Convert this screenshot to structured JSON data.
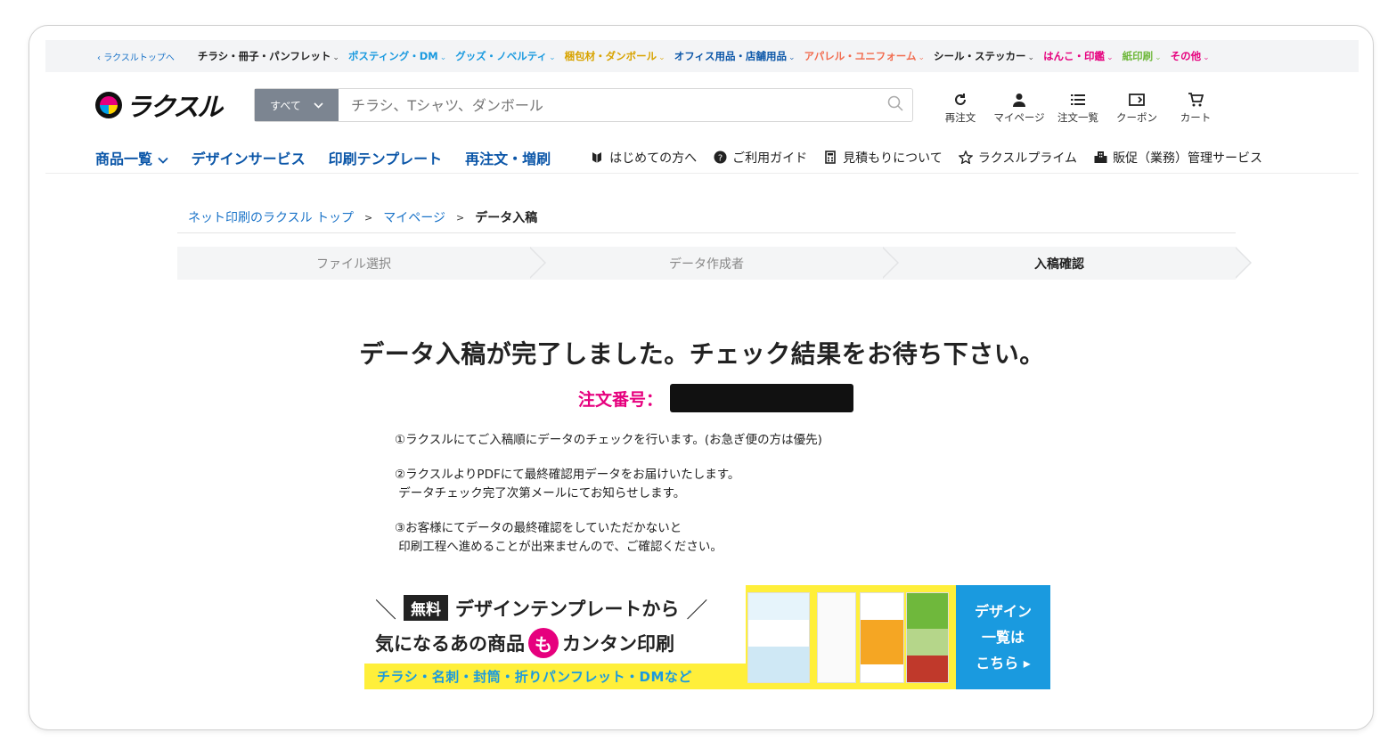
{
  "category_bar": {
    "back": "ラクスルトップへ",
    "items": [
      {
        "label": "チラシ・冊子・パンフレット",
        "color": "#222222"
      },
      {
        "label": "ポスティング・DM",
        "color": "#1a9adf"
      },
      {
        "label": "グッズ・ノベルティ",
        "color": "#1a9adf"
      },
      {
        "label": "梱包材・ダンボール",
        "color": "#d8a300"
      },
      {
        "label": "オフィス用品・店舗用品",
        "color": "#0b56a8"
      },
      {
        "label": "アパレル・ユニフォーム",
        "color": "#f26c4f"
      },
      {
        "label": "シール・ステッカー",
        "color": "#222222"
      },
      {
        "label": "はんこ・印鑑",
        "color": "#e6007e"
      },
      {
        "label": "紙印刷",
        "color": "#6fb83c"
      },
      {
        "label": "その他",
        "color": "#e6007e"
      }
    ]
  },
  "header": {
    "logo_text": "ラクスル",
    "search": {
      "scope": "すべて",
      "placeholder": "チラシ、Tシャツ、ダンボール"
    },
    "icons": [
      {
        "name": "reorder",
        "label": "再注文"
      },
      {
        "name": "mypage",
        "label": "マイページ"
      },
      {
        "name": "orders",
        "label": "注文一覧"
      },
      {
        "name": "coupon",
        "label": "クーポン"
      },
      {
        "name": "cart",
        "label": "カート"
      }
    ]
  },
  "nav": {
    "main": [
      "商品一覧",
      "デザインサービス",
      "印刷テンプレート",
      "再注文・増刷"
    ],
    "sub": [
      "はじめての方へ",
      "ご利用ガイド",
      "見積もりについて",
      "ラクスルプライム",
      "販促（業務）管理サービス"
    ]
  },
  "breadcrumb": {
    "items": [
      "ネット印刷のラクスル トップ",
      "マイページ"
    ],
    "current": "データ入稿",
    "sep": ">"
  },
  "steps": [
    "ファイル選択",
    "データ作成者",
    "入稿確認"
  ],
  "main": {
    "title": "データ入稿が完了しました。チェック結果をお待ち下さい。",
    "order_label": "注文番号：",
    "notes": [
      [
        "①ラクスルにてご入稿順にデータのチェックを行います。(お急ぎ便の方は優先)"
      ],
      [
        "②ラクスルよりPDFにて最終確認用データをお届けいたします。",
        "データチェック完了次第メールにてお知らせします。"
      ],
      [
        "③お客様にてデータの最終確認をしていただかないと",
        "印刷工程へ進めることが出来ませんので、ご確認ください。"
      ]
    ]
  },
  "banner": {
    "free_tag": "無料",
    "line1": "デザインテンプレートから",
    "line2_a": "気になるあの商品",
    "line2_mo": "も",
    "line2_b": "カンタン印刷",
    "line3": "チラシ・名刺・封筒・折りパンフレット・DMなど",
    "cta": [
      "デザイン",
      "一覧は",
      "こちら ▸"
    ]
  }
}
